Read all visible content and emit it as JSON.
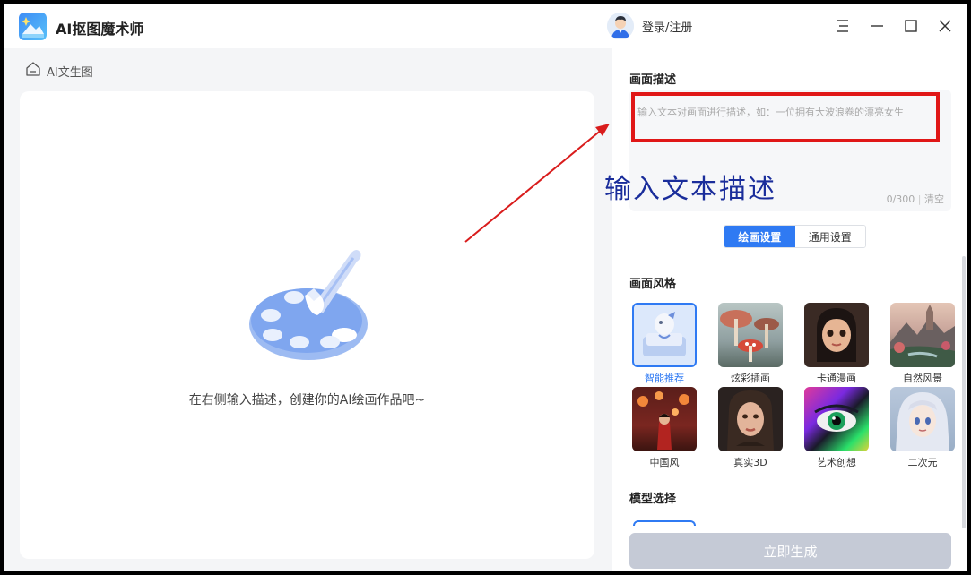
{
  "app": {
    "title": "AI抠图魔术师",
    "login_label": "登录/注册"
  },
  "breadcrumb": {
    "label": "AI文生图"
  },
  "canvas": {
    "empty_text": "在右侧输入描述，创建你的AI绘画作品吧~"
  },
  "description": {
    "title": "画面描述",
    "placeholder": "输入文本对画面进行描述，如：一位拥有大波浪卷的漂亮女生",
    "counter": "0/300",
    "clear_label": "清空",
    "annotation": "输入文本描述"
  },
  "tabs": [
    {
      "label": "绘画设置",
      "active": true
    },
    {
      "label": "通用设置",
      "active": false
    }
  ],
  "style_section": {
    "title": "画面风格",
    "items": [
      {
        "label": "智能推荐",
        "selected": true
      },
      {
        "label": "炫彩插画",
        "selected": false
      },
      {
        "label": "卡通漫画",
        "selected": false
      },
      {
        "label": "自然风景",
        "selected": false
      },
      {
        "label": "中国风",
        "selected": false
      },
      {
        "label": "真实3D",
        "selected": false
      },
      {
        "label": "艺术创想",
        "selected": false
      },
      {
        "label": "二次元",
        "selected": false
      }
    ]
  },
  "model_section": {
    "title": "模型选择"
  },
  "generate_button": {
    "label": "立即生成"
  },
  "colors": {
    "accent": "#2f7af3",
    "annotation_red": "#e01717",
    "annotation_text": "#1a2d9b"
  }
}
